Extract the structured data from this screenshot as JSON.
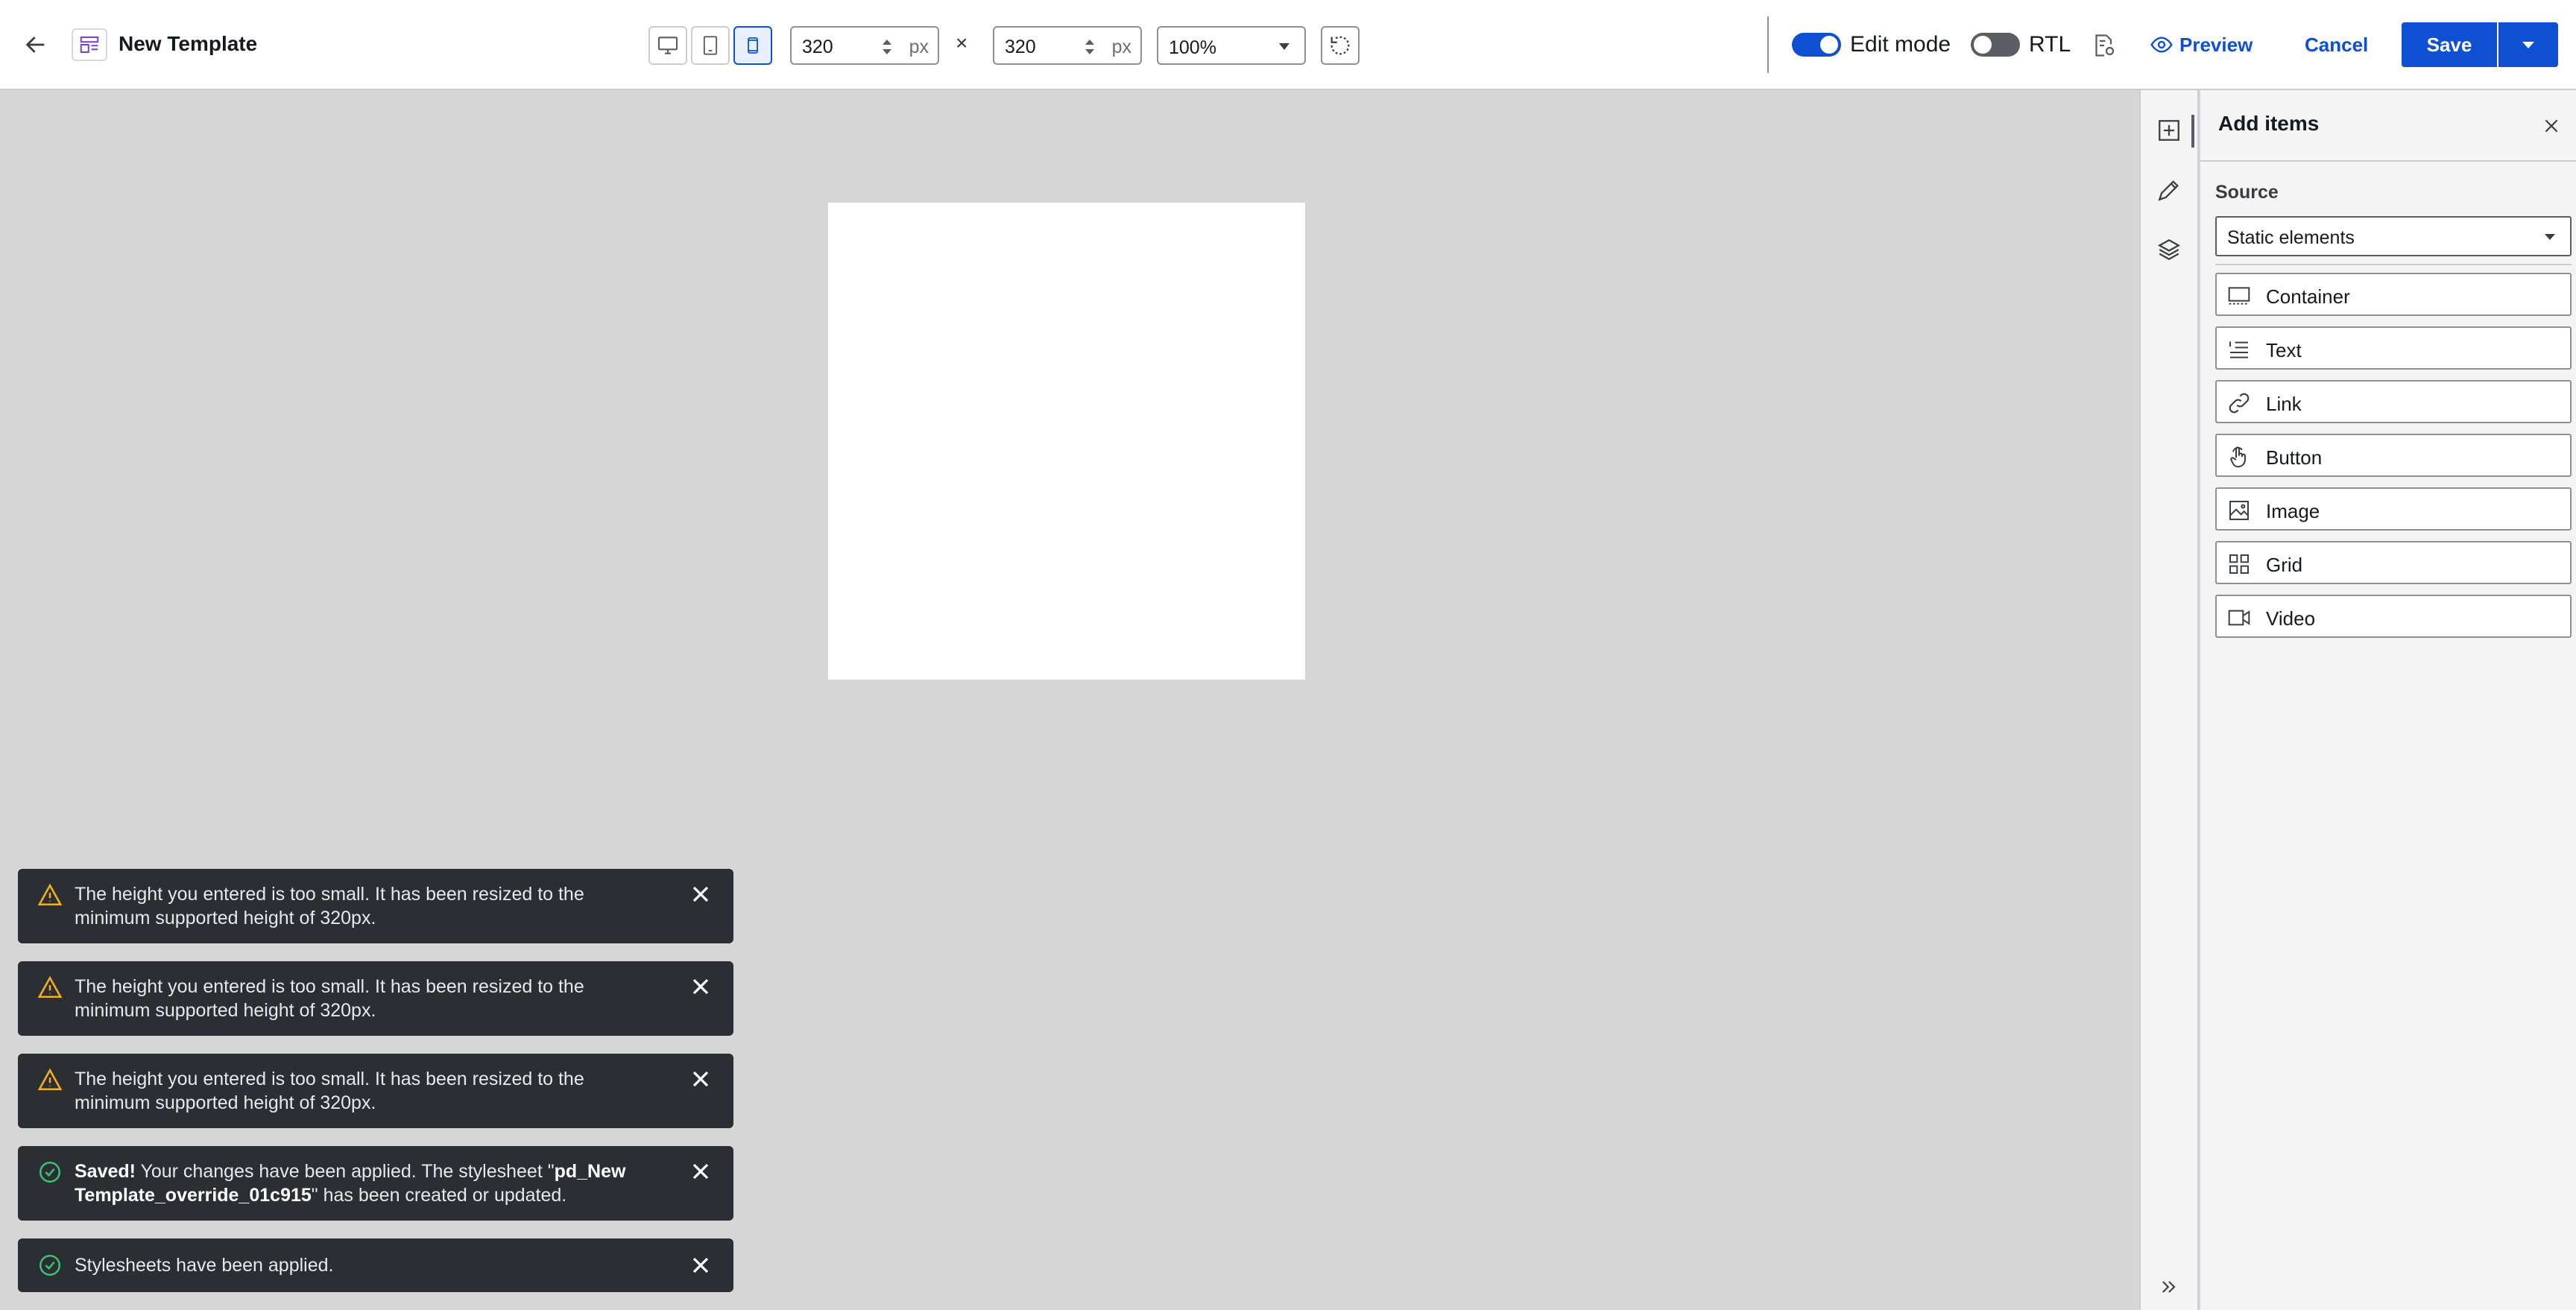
{
  "header": {
    "title": "New Template",
    "back_icon": "arrow-left-icon",
    "template_icon": "template-icon",
    "width_value": "320",
    "width_unit": "px",
    "height_value": "320",
    "height_unit": "px",
    "times": "×",
    "zoom_value": "100%",
    "edit_mode_label": "Edit mode",
    "edit_mode_on": true,
    "rtl_label": "RTL",
    "rtl_on": false,
    "preview_label": "Preview",
    "cancel_label": "Cancel",
    "save_label": "Save",
    "active_device": "mobile"
  },
  "panel": {
    "title": "Add items",
    "source_label": "Source",
    "source_value": "Static elements",
    "items": [
      {
        "label": "Container",
        "icon": "container-icon"
      },
      {
        "label": "Text",
        "icon": "text-icon"
      },
      {
        "label": "Link",
        "icon": "link-icon"
      },
      {
        "label": "Button",
        "icon": "pointer-hand-icon"
      },
      {
        "label": "Image",
        "icon": "image-icon"
      },
      {
        "label": "Grid",
        "icon": "grid-icon"
      },
      {
        "label": "Video",
        "icon": "video-icon"
      }
    ]
  },
  "toasts": [
    {
      "type": "warning",
      "text": "The height you entered is too small. It has been resized to the minimum supported height of 320px."
    },
    {
      "type": "warning",
      "text": "The height you entered is too small. It has been resized to the minimum supported height of 320px."
    },
    {
      "type": "warning",
      "text": "The height you entered is too small. It has been resized to the minimum supported height of 320px."
    },
    {
      "type": "success",
      "bold": "Saved!",
      "text": " Your changes have been applied. The stylesheet \"",
      "bold2": "pd_New Template_override_01c915",
      "text2": "\" has been created or updated."
    },
    {
      "type": "success",
      "text": "Stylesheets have been applied."
    }
  ],
  "colors": {
    "accent": "#0f4fd1",
    "toast_bg": "#2b2e33",
    "warning": "#f2b01e",
    "success": "#3fbf72"
  }
}
